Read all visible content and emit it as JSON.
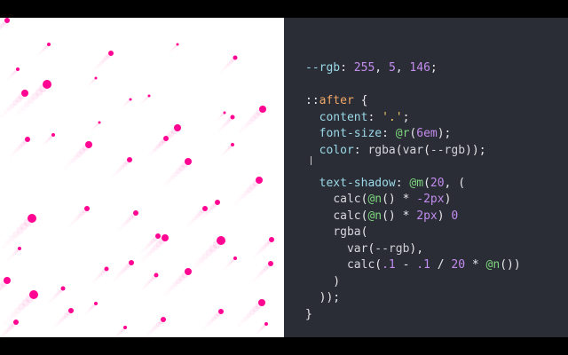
{
  "accent_color": "#ff0592",
  "panels": {
    "preview_bg": "#ffffff",
    "editor_bg": "#2a2d35",
    "letterbox_bg": "#000000"
  },
  "code_lines": [
    [
      {
        "t": "--rgb",
        "c": "prop"
      },
      {
        "t": ": ",
        "c": "plain"
      },
      {
        "t": "255",
        "c": "num"
      },
      {
        "t": ", ",
        "c": "plain"
      },
      {
        "t": "5",
        "c": "num"
      },
      {
        "t": ", ",
        "c": "plain"
      },
      {
        "t": "146",
        "c": "num"
      },
      {
        "t": ";",
        "c": "plain"
      }
    ],
    [],
    [
      {
        "t": "::",
        "c": "sel"
      },
      {
        "t": "after",
        "c": "pseudo"
      },
      {
        "t": " {",
        "c": "plain"
      }
    ],
    [
      {
        "t": "  ",
        "c": "plain"
      },
      {
        "t": "content",
        "c": "prop"
      },
      {
        "t": ": ",
        "c": "plain"
      },
      {
        "t": "'.'",
        "c": "str"
      },
      {
        "t": ";",
        "c": "plain"
      }
    ],
    [
      {
        "t": "  ",
        "c": "plain"
      },
      {
        "t": "font-size",
        "c": "prop"
      },
      {
        "t": ": ",
        "c": "plain"
      },
      {
        "t": "@r",
        "c": "at"
      },
      {
        "t": "(",
        "c": "plain"
      },
      {
        "t": "6em",
        "c": "num"
      },
      {
        "t": ");",
        "c": "plain"
      }
    ],
    [
      {
        "t": "  ",
        "c": "plain"
      },
      {
        "t": "color",
        "c": "prop"
      },
      {
        "t": ": ",
        "c": "plain"
      },
      {
        "t": "rgba",
        "c": "fn"
      },
      {
        "t": "(",
        "c": "plain"
      },
      {
        "t": "var",
        "c": "fn"
      },
      {
        "t": "(",
        "c": "plain"
      },
      {
        "t": "--rgb",
        "c": "var"
      },
      {
        "t": "));",
        "c": "plain"
      }
    ],
    [],
    [
      {
        "t": "  ",
        "c": "plain"
      },
      {
        "t": "text-shadow",
        "c": "prop"
      },
      {
        "t": ": ",
        "c": "plain"
      },
      {
        "t": "@m",
        "c": "at"
      },
      {
        "t": "(",
        "c": "plain"
      },
      {
        "t": "20",
        "c": "num"
      },
      {
        "t": ", (",
        "c": "plain"
      }
    ],
    [
      {
        "t": "    ",
        "c": "plain"
      },
      {
        "t": "calc",
        "c": "fn"
      },
      {
        "t": "(",
        "c": "plain"
      },
      {
        "t": "@n",
        "c": "at"
      },
      {
        "t": "() * ",
        "c": "plain"
      },
      {
        "t": "-2px",
        "c": "num"
      },
      {
        "t": ")",
        "c": "plain"
      }
    ],
    [
      {
        "t": "    ",
        "c": "plain"
      },
      {
        "t": "calc",
        "c": "fn"
      },
      {
        "t": "(",
        "c": "plain"
      },
      {
        "t": "@n",
        "c": "at"
      },
      {
        "t": "() * ",
        "c": "plain"
      },
      {
        "t": "2px",
        "c": "num"
      },
      {
        "t": ") ",
        "c": "plain"
      },
      {
        "t": "0",
        "c": "num"
      }
    ],
    [
      {
        "t": "    ",
        "c": "plain"
      },
      {
        "t": "rgba",
        "c": "fn"
      },
      {
        "t": "(",
        "c": "plain"
      }
    ],
    [
      {
        "t": "      ",
        "c": "plain"
      },
      {
        "t": "var",
        "c": "fn"
      },
      {
        "t": "(",
        "c": "plain"
      },
      {
        "t": "--rgb",
        "c": "var"
      },
      {
        "t": "),",
        "c": "plain"
      }
    ],
    [
      {
        "t": "      ",
        "c": "plain"
      },
      {
        "t": "calc",
        "c": "fn"
      },
      {
        "t": "(",
        "c": "plain"
      },
      {
        "t": ".1",
        "c": "num"
      },
      {
        "t": " - ",
        "c": "plain"
      },
      {
        "t": ".1",
        "c": "num"
      },
      {
        "t": " / ",
        "c": "plain"
      },
      {
        "t": "20",
        "c": "num"
      },
      {
        "t": " * ",
        "c": "plain"
      },
      {
        "t": "@n",
        "c": "at"
      },
      {
        "t": "())",
        "c": "plain"
      }
    ],
    [
      {
        "t": "    )",
        "c": "plain"
      }
    ],
    [
      {
        "t": "  ));",
        "c": "plain"
      }
    ],
    [
      {
        "t": "}",
        "c": "plain"
      }
    ]
  ]
}
